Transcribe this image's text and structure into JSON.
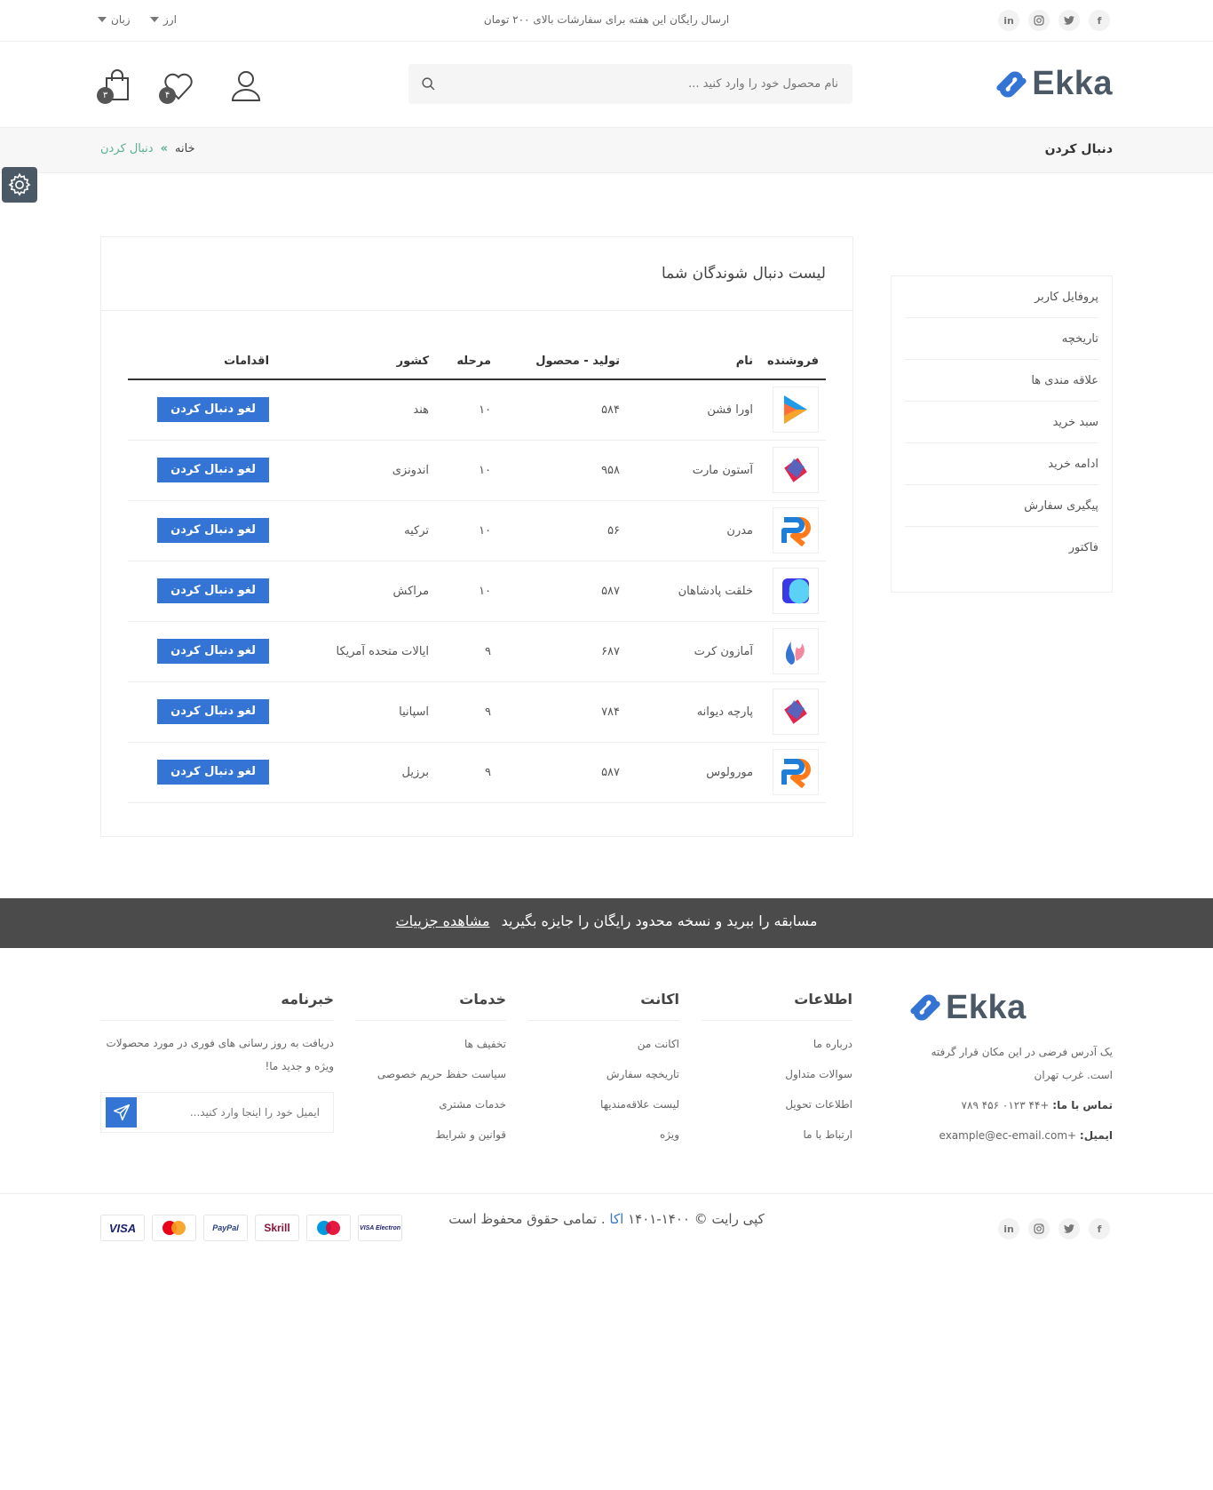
{
  "topbar": {
    "promo": "ارسال رایگان این هفته برای سفارشات بالای ۲۰۰ تومان",
    "currency_label": "ارز",
    "language_label": "زبان",
    "social": [
      "in",
      "ig",
      "tw",
      "f"
    ]
  },
  "header": {
    "logo_text": "Ekka",
    "search_placeholder": "نام محصول خود را وارد کنید ...",
    "wishlist_count": "۴",
    "cart_count": "۳"
  },
  "breadcrumb": {
    "page_title": "دنبال کردن",
    "home": "خانه",
    "separator": "»",
    "current": "دنبال کردن"
  },
  "sidebar": {
    "items": [
      "پروفایل کاربر",
      "تاریخچه",
      "علاقه مندی ها",
      "سبد خرید",
      "ادامه خرید",
      "پیگیری سفارش",
      "فاکتور"
    ]
  },
  "panel": {
    "title": "لیست دنبال شوندگان شما",
    "columns": [
      "فروشنده",
      "نام",
      "تولید - محصول",
      "مرحله",
      "کشور",
      "اقدامات"
    ],
    "rows": [
      {
        "name": "اورا فشن",
        "products": "۵۸۴",
        "level": "۱۰",
        "country": "هند",
        "action": "لغو دنبال کردن",
        "logo": "play-logo"
      },
      {
        "name": "آستون مارت",
        "products": "۹۵۸",
        "level": "۱۰",
        "country": "اندونزی",
        "action": "لغو دنبال کردن",
        "logo": "diamond-logo"
      },
      {
        "name": "مدرن",
        "products": "۵۶",
        "level": "۱۰",
        "country": "ترکیه",
        "action": "لغو دنبال کردن",
        "logo": "r-logo"
      },
      {
        "name": "خلقت پادشاهان",
        "products": "۵۸۷",
        "level": "۱۰",
        "country": "مراکش",
        "action": "لغو دنبال کردن",
        "logo": "blob-logo"
      },
      {
        "name": "آمازون کرت",
        "products": "۶۸۷",
        "level": "۹",
        "country": "ایالات متحده آمریکا",
        "action": "لغو دنبال کردن",
        "logo": "flame-logo"
      },
      {
        "name": "پارچه دیوانه",
        "products": "۷۸۴",
        "level": "۹",
        "country": "اسپانیا",
        "action": "لغو دنبال کردن",
        "logo": "diamond-logo"
      },
      {
        "name": "مورولوس",
        "products": "۵۸۷",
        "level": "۹",
        "country": "برزیل",
        "action": "لغو دنبال کردن",
        "logo": "r-logo"
      }
    ]
  },
  "banner": {
    "text": "مسابقه را ببرید و نسخه محدود رایگان را جایزه بگیرید",
    "link": "مشاهده جزییات"
  },
  "footer": {
    "about": {
      "address": "یک آدرس فرضی در این مکان قرار گرفته است. غرب تهران",
      "phone_label": "تماس با ما:",
      "phone": "+۴۴ ۰۱۲۳ ۴۵۶ ۷۸۹",
      "email_label": "ایمیل:",
      "email": "+example@ec-email.com"
    },
    "info": {
      "title": "اطلاعات",
      "links": [
        "درباره ما",
        "سوالات متداول",
        "اطلاعات تحویل",
        "ارتباط با ما"
      ]
    },
    "account": {
      "title": "اکانت",
      "links": [
        "اکانت من",
        "تاریخچه سفارش",
        "لیست علاقه‌مندیها",
        "ویژه"
      ]
    },
    "services": {
      "title": "خدمات",
      "links": [
        "تخفیف ها",
        "سیاست حفظ حریم خصوصی",
        "خدمات مشتری",
        "قوانین و شرایط"
      ]
    },
    "newsletter": {
      "title": "خبرنامه",
      "text": "دریافت به روز رسانی های فوری در مورد محصولات ویژه و جدید ما!",
      "placeholder": "ایمیل خود را اینجا وارد کنید..."
    },
    "copyright_pre": "کپی رایت © ۱۴۰۰-۱۴۰۱",
    "copyright_brand": "اکا",
    "copyright_post": ". تمامی حقوق محفوظ است",
    "payments": [
      "VISA Electron",
      "Maestro",
      "Skrill",
      "PayPal",
      "MasterCard",
      "VISA"
    ]
  },
  "colors": {
    "accent": "#3474d4",
    "green": "#5caf90",
    "banner": "#4b4b4b"
  }
}
